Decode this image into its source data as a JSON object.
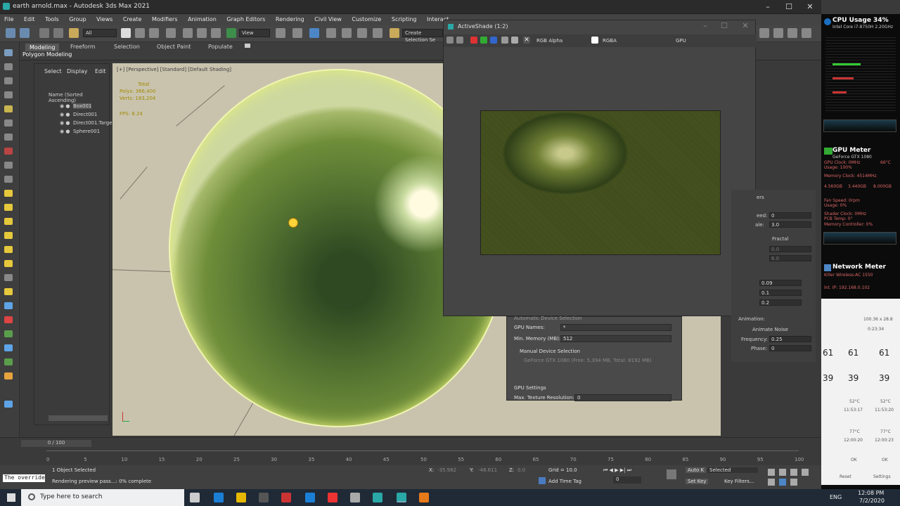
{
  "window": {
    "title": "earth arnold.max - Autodesk 3ds Max 2021",
    "minimize": "–",
    "maximize": "☐",
    "close": "✕"
  },
  "menu": [
    "File",
    "Edit",
    "Tools",
    "Group",
    "Views",
    "Create",
    "Modifiers",
    "Animation",
    "Graph Editors",
    "Rendering",
    "Civil View",
    "Customize",
    "Scripting",
    "Interact"
  ],
  "toolbar": {
    "selection_filter": "All",
    "view_label": "View",
    "create_selection_set": "Create Selection Se"
  },
  "ribbon": {
    "tabs": [
      "Modeling",
      "Freeform",
      "Selection",
      "Object Paint",
      "Populate"
    ],
    "sub_label": "Polygon Modeling"
  },
  "explorer": {
    "tabs": [
      "Select",
      "Display",
      "Edit"
    ],
    "column_header": "Name (Sorted Ascending)",
    "items": [
      "Box001",
      "Direct001",
      "Direct001.Targe",
      "Sphere001"
    ]
  },
  "viewport": {
    "label": "[+] [Perspective] [Standard] [Default Shading]",
    "stats_header": "Total",
    "polys_label": "Polys:",
    "polys_value": "366,400",
    "verts_label": "Verts:",
    "verts_value": "183,204",
    "fps_label": "FPS:",
    "fps_value": "8.24"
  },
  "activeshade": {
    "title": "ActiveShade (1:2)",
    "channel": "RGB Alpha",
    "display": "RGBA",
    "device": "GPU"
  },
  "render_setup": {
    "section_hidden": "Automatic Device Selection",
    "gpu_names_label": "GPU Names:",
    "gpu_names_value": "*",
    "min_memory_label": "Min. Memory (MB):",
    "min_memory_value": "512",
    "manual_label": "Manual Device Selection",
    "gpu_device": "GeForce GTX 1080 (Free: 5,394 MB, Total: 8192 MB)",
    "gpu_settings_label": "GPU Settings",
    "max_tex_label": "Max. Texture Resolution:",
    "max_tex_value": "0"
  },
  "command_panel": {
    "rollout": "ers",
    "seed_label": "eed:",
    "seed_value": "0",
    "scale_label": "ale:",
    "scale_value": "3.0",
    "fractal_label": "Fractal",
    "v1": "0.0",
    "v2": "6.0",
    "v3": "0.09",
    "v4": "0.1",
    "v5": "0.2",
    "animation_label": "Animation:",
    "animate_noise": "Animate Noise",
    "frequency_label": "Frequency:",
    "frequency_value": "0.25",
    "phase_label": "Phase:",
    "phase_value": "0"
  },
  "timeline": {
    "slider": "0 / 100",
    "ticks": [
      "0",
      "5",
      "10",
      "15",
      "20",
      "25",
      "30",
      "35",
      "40",
      "45",
      "50",
      "55",
      "60",
      "65",
      "70",
      "75",
      "80",
      "85",
      "90",
      "95",
      "100"
    ]
  },
  "status": {
    "listener": "The override",
    "selected": "1 Object Selected",
    "progress": "Rendering preview pass...: 0% complete",
    "x_label": "X:",
    "x_value": "-35.982",
    "y_label": "Y:",
    "y_value": "-48.611",
    "z_label": "Z:",
    "z_value": "0.0",
    "grid": "Grid = 10.0",
    "add_time_tag": "Add Time Tag",
    "frame": "0",
    "auto_key": "Auto K",
    "selected_dropdown": "Selected",
    "set_key": "Set Key",
    "key_filters": "Key Filters..."
  },
  "taskbar": {
    "search_placeholder": "Type here to search",
    "lang": "ENG",
    "time": "12:08 PM",
    "date": "7/2/2020"
  },
  "gadgets": {
    "cpu_title": "CPU Usage 34%",
    "cpu_model": "Intel Core i7-8750H 2.20GHz",
    "gpu_title": "GPU Meter",
    "gpu_model": "GeForce GTX 1080",
    "gpu_clock": "GPU Clock: 0MHz",
    "gpu_temp": "66°C",
    "gpu_usage": "Usage: 100%",
    "mem_clock": "Memory Clock: 4514MHz",
    "mem_used": "4.560GB",
    "mem_free": "3.440GB",
    "mem_total": "8.000GB",
    "fan": "Fan Speed: 0rpm",
    "usage0": "Usage: 0%",
    "shader": "Shader Clock: 0MHz",
    "pcb": "PCB Temp: 0°",
    "memctl": "Memory Controller: 0%",
    "net_title": "Network Meter",
    "net_adapter": "Killer Wireless-AC 1550",
    "net_ip": "Int. IP: 192.168.0.102"
  },
  "monitor": {
    "header": "100.36 x 28.8",
    "time": "0:23:34",
    "r1c1": "61",
    "r1c2": "61",
    "r1c0": "61",
    "r2c0": "39",
    "r2c1": "39",
    "r2c2": "39",
    "t1": "52°C",
    "t2": "52°C",
    "t3": "11:53:17",
    "t4": "11:53:20",
    "t5": "77°C",
    "t6": "77°C",
    "t7": "12:00:20",
    "t8": "12:00:23",
    "ok": "OK",
    "reset": "Reset",
    "settings": "Settings"
  }
}
